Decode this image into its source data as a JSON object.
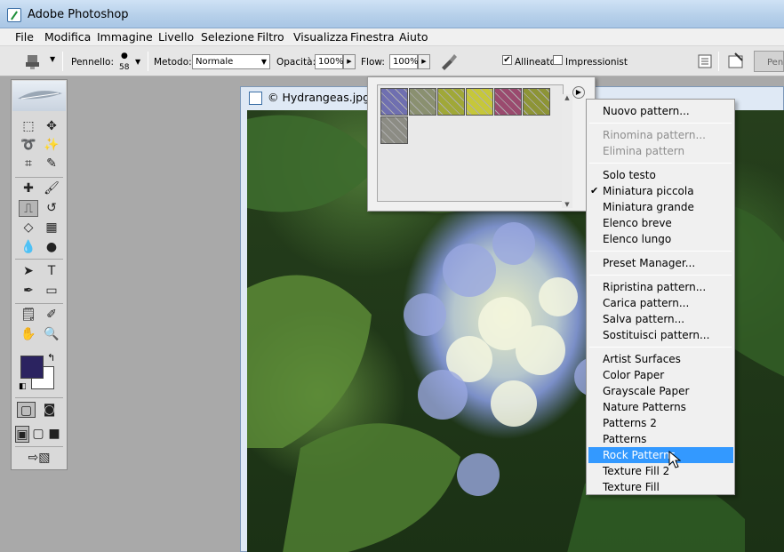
{
  "window": {
    "title": "Adobe Photoshop"
  },
  "menubar": {
    "items": [
      "File",
      "Modifica",
      "Immagine",
      "Livello",
      "Selezione",
      "Filtro",
      "Visualizza",
      "Finestra",
      "Aiuto"
    ]
  },
  "options": {
    "brush_label": "Pennello:",
    "brush_size": "58",
    "mode_label": "Metodo:",
    "mode_value": "Normale",
    "opacity_label": "Opacità:",
    "opacity_value": "100%",
    "flow_label": "Flow:",
    "flow_value": "100%",
    "aligned_label": "Allineato",
    "aligned_checked": true,
    "impressionist_label": "Impressionist",
    "impressionist_checked": false,
    "panel_tab_label": "Penn"
  },
  "document": {
    "title": "© Hydrangeas.jpg @"
  },
  "pattern_swatches": [
    {
      "name": "pattern-1",
      "color": "#6f6fb0"
    },
    {
      "name": "pattern-2",
      "color": "#8a9070"
    },
    {
      "name": "pattern-3",
      "color": "#a0a838"
    },
    {
      "name": "pattern-4",
      "color": "#c6c73a"
    },
    {
      "name": "pattern-5",
      "color": "#9a4a6e"
    },
    {
      "name": "pattern-6",
      "color": "#8d9436"
    },
    {
      "name": "pattern-7",
      "color": "#8c8c84"
    }
  ],
  "flyout_menu": {
    "groups": [
      [
        {
          "label": "Nuovo pattern...",
          "enabled": true
        }
      ],
      [
        {
          "label": "Rinomina pattern...",
          "enabled": false
        },
        {
          "label": "Elimina pattern",
          "enabled": false
        }
      ],
      [
        {
          "label": "Solo testo",
          "enabled": true
        },
        {
          "label": "Miniatura piccola",
          "enabled": true,
          "checked": true
        },
        {
          "label": "Miniatura grande",
          "enabled": true
        },
        {
          "label": "Elenco breve",
          "enabled": true
        },
        {
          "label": "Elenco lungo",
          "enabled": true
        }
      ],
      [
        {
          "label": "Preset Manager...",
          "enabled": true
        }
      ],
      [
        {
          "label": "Ripristina pattern...",
          "enabled": true
        },
        {
          "label": "Carica pattern...",
          "enabled": true
        },
        {
          "label": "Salva pattern...",
          "enabled": true
        },
        {
          "label": "Sostituisci pattern...",
          "enabled": true
        }
      ],
      [
        {
          "label": "Artist Surfaces",
          "enabled": true
        },
        {
          "label": "Color Paper",
          "enabled": true
        },
        {
          "label": "Grayscale Paper",
          "enabled": true
        },
        {
          "label": "Nature Patterns",
          "enabled": true
        },
        {
          "label": "Patterns 2",
          "enabled": true
        },
        {
          "label": "Patterns",
          "enabled": true
        },
        {
          "label": "Rock Patterns",
          "enabled": true,
          "highlighted": true
        },
        {
          "label": "Texture Fill 2",
          "enabled": true
        },
        {
          "label": "Texture Fill",
          "enabled": true
        }
      ]
    ]
  },
  "colors": {
    "foreground": "#2b2360",
    "background": "#ffffff",
    "highlight": "#3399ff",
    "selected_swatch": "#c8c830"
  }
}
